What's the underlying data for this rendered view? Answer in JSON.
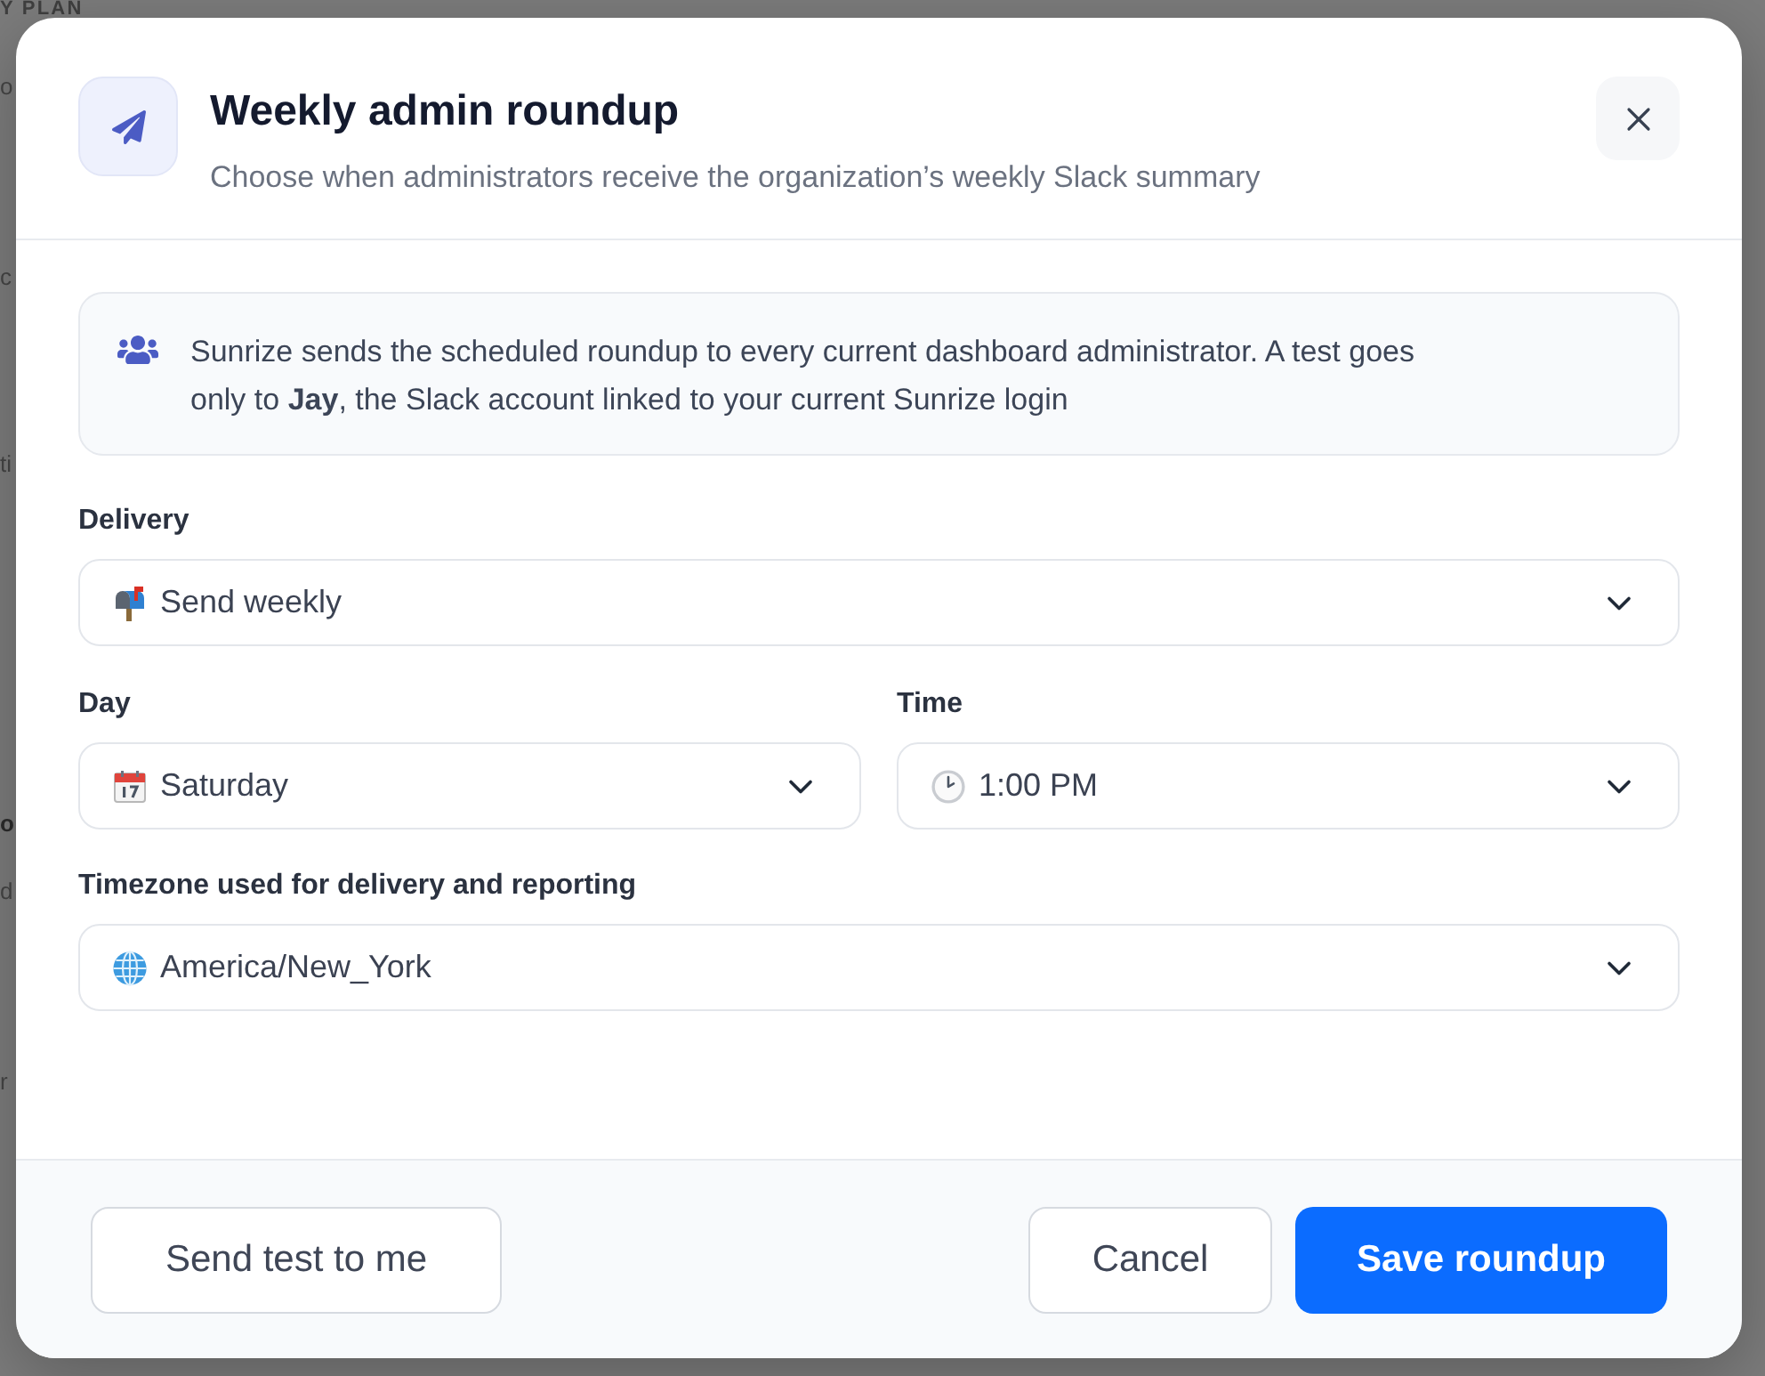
{
  "background": {
    "heading": "Y PLAN",
    "fragments": [
      "o",
      "c",
      "ti",
      "o",
      "d",
      "r"
    ]
  },
  "dialog": {
    "title": "Weekly admin roundup",
    "subtitle": "Choose when administrators receive the organization’s weekly Slack summary",
    "notice": "Sunrize sends the scheduled roundup to every current dashboard administrator. A test goes only to **Jay**, the Slack account linked to your current Sunrize login",
    "delivery": {
      "label": "Delivery",
      "value": "Send weekly"
    },
    "day": {
      "label": "Day",
      "value": "Saturday"
    },
    "time": {
      "label": "Time",
      "value": "1:00 PM"
    },
    "timezone": {
      "label": "Timezone used for delivery and reporting",
      "value": "America/New_York"
    },
    "footer": {
      "test_button": "Send test to me",
      "cancel_button": "Cancel",
      "save_button": "Save roundup"
    }
  }
}
